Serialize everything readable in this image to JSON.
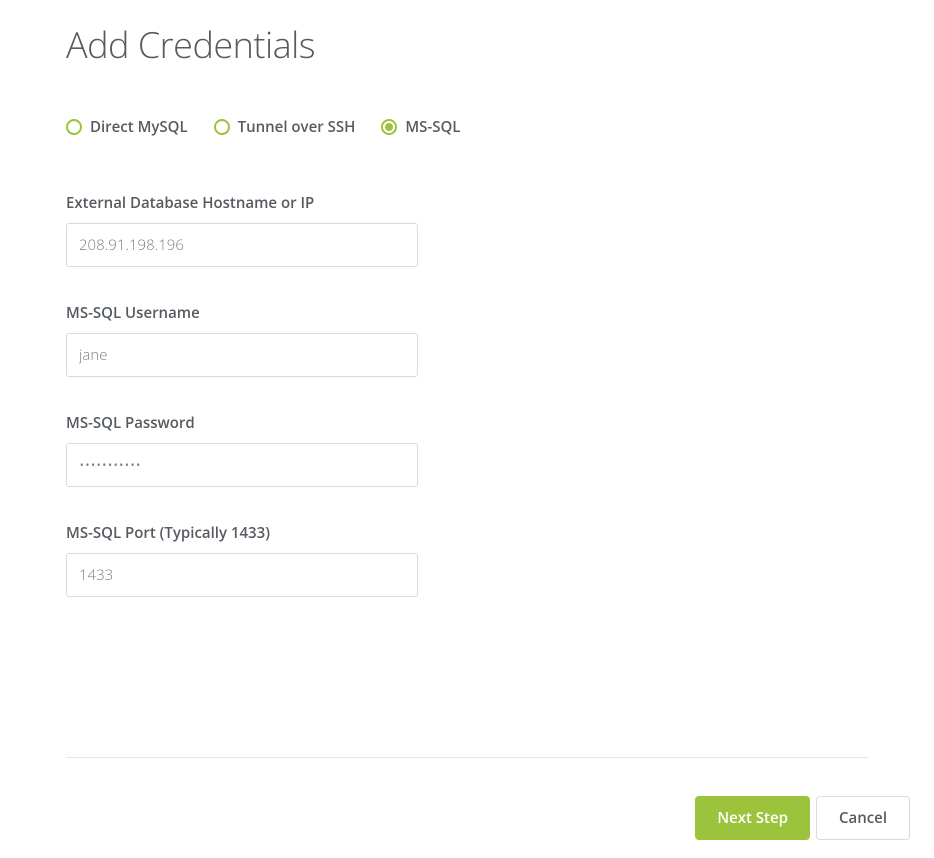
{
  "title": "Add Credentials",
  "connection_types": {
    "options": [
      {
        "label": "Direct MySQL",
        "selected": false
      },
      {
        "label": "Tunnel over SSH",
        "selected": false
      },
      {
        "label": "MS-SQL",
        "selected": true
      }
    ]
  },
  "form": {
    "hostname": {
      "label": "External Database Hostname or IP",
      "value": "208.91.198.196"
    },
    "username": {
      "label": "MS-SQL Username",
      "value": "jane"
    },
    "password": {
      "label": "MS-SQL Password",
      "value": "•••••••••••"
    },
    "port": {
      "label": "MS-SQL Port (Typically 1433)",
      "value": "1433"
    }
  },
  "actions": {
    "next": "Next Step",
    "cancel": "Cancel"
  }
}
